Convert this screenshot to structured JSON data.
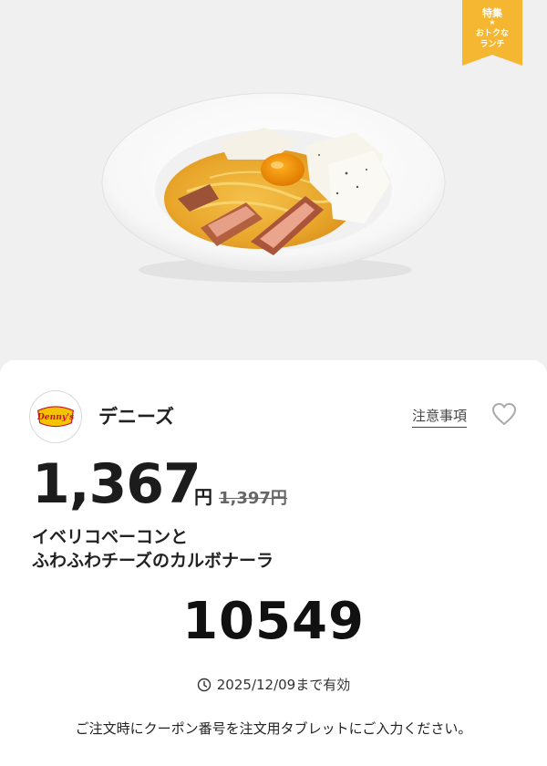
{
  "ribbon": {
    "title": "特集",
    "star": "★",
    "line1": "おトクな",
    "line2": "ランチ",
    "color": "#f5b731"
  },
  "brand": {
    "name": "デニーズ",
    "logo_text": "Denny's",
    "logo_color": "#f5c400",
    "logo_text_color": "#c8102e"
  },
  "header": {
    "notes_label": "注意事項",
    "favorite_icon": "heart-outline-icon"
  },
  "price": {
    "current": "1,367",
    "yen": "円",
    "original": "1,397円"
  },
  "product": {
    "line1": "イベリコベーコンと",
    "line2": "ふわふわチーズのカルボナーラ",
    "photo": "carbonara-dish-photo"
  },
  "coupon": {
    "code": "10549"
  },
  "validity": {
    "icon": "clock-icon",
    "text": "2025/12/09まで有効"
  },
  "instruction": {
    "text": "ご注文時にクーポン番号を注文用タブレットにご入力ください。"
  }
}
